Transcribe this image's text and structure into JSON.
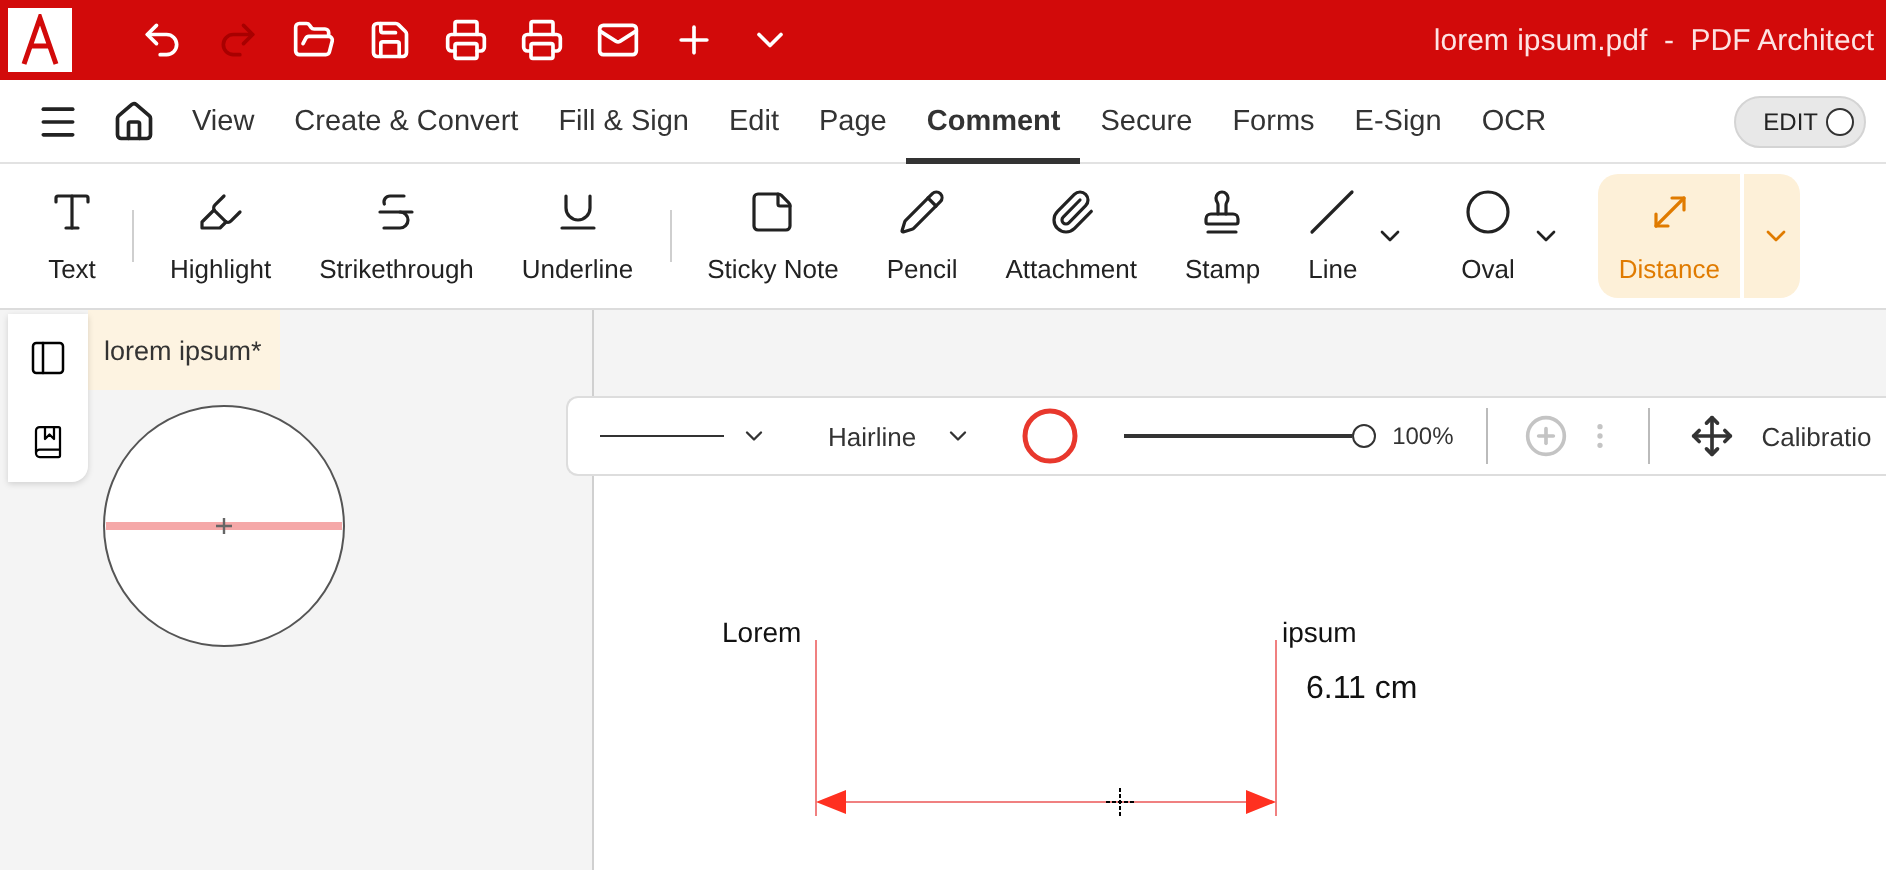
{
  "window": {
    "title": "lorem ipsum.pdf  -  PDF Architect"
  },
  "menu": {
    "tabs": [
      {
        "label": "View",
        "selected": false
      },
      {
        "label": "Create & Convert",
        "selected": false
      },
      {
        "label": "Fill & Sign",
        "selected": false
      },
      {
        "label": "Edit",
        "selected": false
      },
      {
        "label": "Page",
        "selected": false
      },
      {
        "label": "Comment",
        "selected": true
      },
      {
        "label": "Secure",
        "selected": false
      },
      {
        "label": "Forms",
        "selected": false
      },
      {
        "label": "E-Sign",
        "selected": false
      },
      {
        "label": "OCR",
        "selected": false
      }
    ],
    "edit_toggle": {
      "label": "EDIT"
    }
  },
  "ribbon": [
    {
      "kind": "tool",
      "label": "Text",
      "selected": false
    },
    {
      "kind": "separator"
    },
    {
      "kind": "tool",
      "label": "Highlight",
      "selected": false
    },
    {
      "kind": "tool",
      "label": "Strikethrough",
      "selected": false
    },
    {
      "kind": "tool",
      "label": "Underline",
      "selected": false
    },
    {
      "kind": "separator"
    },
    {
      "kind": "tool",
      "label": "Sticky Note",
      "selected": false
    },
    {
      "kind": "tool",
      "label": "Pencil",
      "selected": false
    },
    {
      "kind": "tool",
      "label": "Attachment",
      "selected": false
    },
    {
      "kind": "tool",
      "label": "Stamp",
      "selected": false
    },
    {
      "kind": "dropdown",
      "label": "Line",
      "selected": false
    },
    {
      "kind": "dropdown",
      "label": "Oval",
      "selected": false
    },
    {
      "kind": "dropdown",
      "label": "Distance",
      "selected": true
    }
  ],
  "document_tab": {
    "label": "lorem ipsum",
    "modified_mark": "*"
  },
  "properties": {
    "line_weight": "Hairline",
    "color": "#e8382d",
    "opacity": {
      "level": 1,
      "reading": "100%"
    },
    "calibration": "Calibratio"
  },
  "canvas": {
    "start_label": "Lorem",
    "end_label": "ipsum",
    "measurement": "6.11 cm"
  }
}
